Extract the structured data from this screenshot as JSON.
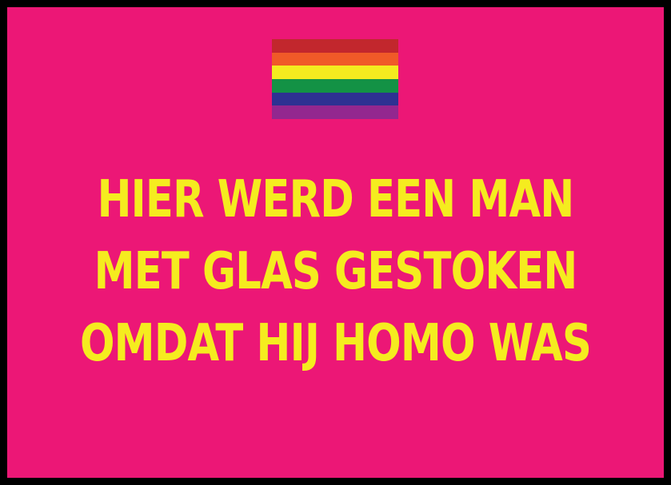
{
  "colors": {
    "background": "#ec1776",
    "border": "#000000",
    "text": "#f5ec1f"
  },
  "flag": {
    "icon": "rainbow-pride-flag-icon",
    "stripes": [
      "#c2272d",
      "#f05a28",
      "#f4eb1f",
      "#139245",
      "#2e3192",
      "#93278f"
    ]
  },
  "message": {
    "line1": "HIER WERD EEN MAN",
    "line2": "MET GLAS GESTOKEN",
    "line3": "OMDAT HIJ HOMO WAS"
  }
}
